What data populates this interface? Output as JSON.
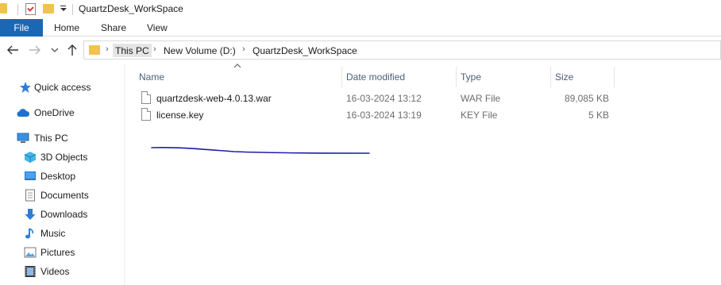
{
  "window": {
    "title": "QuartzDesk_WorkSpace"
  },
  "ribbon": {
    "tabs": [
      "File",
      "Home",
      "Share",
      "View"
    ]
  },
  "address": {
    "crumbs": [
      "This PC",
      "New Volume (D:)",
      "QuartzDesk_WorkSpace"
    ]
  },
  "sidebar": {
    "items": [
      {
        "label": "Quick access",
        "icon": "star-icon"
      },
      {
        "label": "OneDrive",
        "icon": "cloud-icon"
      },
      {
        "label": "This PC",
        "icon": "computer-icon"
      },
      {
        "label": "3D Objects",
        "icon": "cube-icon"
      },
      {
        "label": "Desktop",
        "icon": "desktop-icon"
      },
      {
        "label": "Documents",
        "icon": "document-icon"
      },
      {
        "label": "Downloads",
        "icon": "download-arrow-icon"
      },
      {
        "label": "Music",
        "icon": "music-note-icon"
      },
      {
        "label": "Pictures",
        "icon": "picture-icon"
      },
      {
        "label": "Videos",
        "icon": "film-icon"
      }
    ]
  },
  "columns": [
    "Name",
    "Date modified",
    "Type",
    "Size"
  ],
  "files": [
    {
      "name": "quartzdesk-web-4.0.13.war",
      "date": "16-03-2024 13:12",
      "type": "WAR File",
      "size": "89,085 KB"
    },
    {
      "name": "license.key",
      "date": "16-03-2024 13:19",
      "type": "KEY File",
      "size": "5 KB"
    }
  ],
  "colors": {
    "file_tab": "#1a67b4",
    "folder": "#f1c24d",
    "header_text": "#4c607a",
    "scribble": "#1f1fa8"
  }
}
